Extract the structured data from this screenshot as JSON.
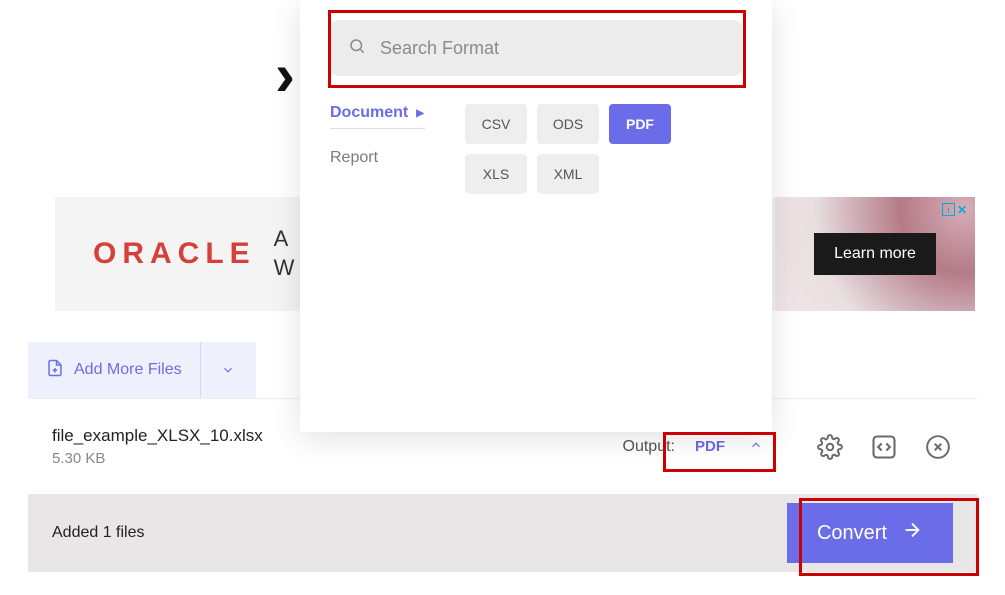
{
  "search": {
    "placeholder": "Search Format"
  },
  "categories": [
    {
      "label": "Document",
      "active": true
    },
    {
      "label": "Report",
      "active": false
    }
  ],
  "formats": [
    {
      "label": "CSV",
      "selected": false
    },
    {
      "label": "ODS",
      "selected": false
    },
    {
      "label": "PDF",
      "selected": true
    },
    {
      "label": "XLS",
      "selected": false
    },
    {
      "label": "XML",
      "selected": false
    }
  ],
  "ad": {
    "brand": "ORACLE",
    "line1": "A",
    "line2": "W",
    "cta": "Learn more"
  },
  "add_files_label": "Add More Files",
  "file": {
    "name": "file_example_XLSX_10.xlsx",
    "size": "5.30 KB"
  },
  "output_label": "Output:",
  "output_value": "PDF",
  "footer_status": "Added 1 files",
  "convert_label": "Convert"
}
